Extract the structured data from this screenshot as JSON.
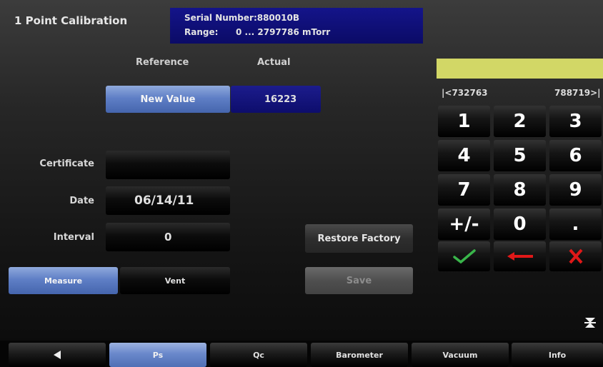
{
  "header": {
    "title": "1 Point Calibration",
    "serial_label": "Serial Number:880010B",
    "range_label": "Range:",
    "range_value": "0 ... 2797786 mTorr"
  },
  "columns": {
    "reference": "Reference",
    "actual": "Actual"
  },
  "new_value_label": "New Value",
  "actual_value": "16223",
  "fields": {
    "certificate": {
      "label": "Certificate",
      "value": ""
    },
    "date": {
      "label": "Date",
      "value": "06/14/11"
    },
    "interval": {
      "label": "Interval",
      "value": "0"
    }
  },
  "buttons": {
    "measure": "Measure",
    "vent": "Vent",
    "restore_factory": "Restore Factory",
    "save": "Save"
  },
  "keypad": {
    "display_value": "",
    "range_min": "|<732763",
    "range_max": "788719>|",
    "keys": [
      "1",
      "2",
      "3",
      "4",
      "5",
      "6",
      "7",
      "8",
      "9",
      "+/-",
      "0",
      "."
    ],
    "enter_icon": "checkmark-icon",
    "backspace_icon": "arrow-left-icon",
    "cancel_icon": "x-icon"
  },
  "tabs": {
    "back_icon": "triangle-left-icon",
    "items": [
      "Ps",
      "Qc",
      "Barometer",
      "Vacuum",
      "Info"
    ],
    "active": "Ps"
  },
  "colors": {
    "accent_blue": "#6a88cb",
    "navy": "#0d0d6c",
    "display_yellow": "#d2d766",
    "check_green": "#39b54a",
    "red": "#e01818"
  }
}
